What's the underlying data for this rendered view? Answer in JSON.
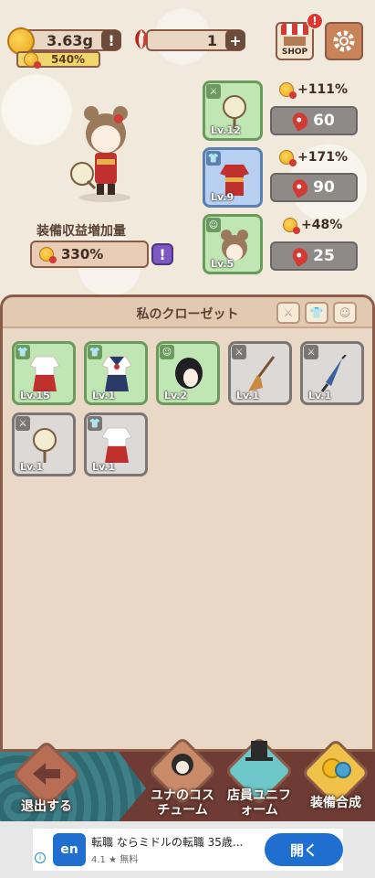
{
  "top_bar": {
    "coin_amount": "3.63g",
    "coin_multiplier": "540%",
    "fish_amount": "1",
    "shop_label": "SHOP",
    "shop_badge": "!",
    "info_symbol": "!",
    "plus_symbol": "+"
  },
  "character": {
    "equip_label": "装備収益増加量",
    "equip_value": "330%"
  },
  "equipped": [
    {
      "level": "Lv.12",
      "bonus": "+111%",
      "cost": "60",
      "type": "weapon",
      "rarity": "green"
    },
    {
      "level": "Lv.9",
      "bonus": "+171%",
      "cost": "90",
      "type": "clothing",
      "rarity": "blue"
    },
    {
      "level": "Lv.5",
      "bonus": "+48%",
      "cost": "25",
      "type": "hair",
      "rarity": "green"
    }
  ],
  "closet": {
    "title": "私のクローゼット",
    "items": [
      {
        "level": "Lv.15",
        "type": "clothing",
        "rarity": "green",
        "art": "miko"
      },
      {
        "level": "Lv.1",
        "type": "clothing",
        "rarity": "green",
        "art": "sailor"
      },
      {
        "level": "Lv.2",
        "type": "hair",
        "rarity": "green",
        "art": "black-hair"
      },
      {
        "level": "Lv.1",
        "type": "weapon",
        "rarity": "grey",
        "art": "broom"
      },
      {
        "level": "Lv.1",
        "type": "weapon",
        "rarity": "grey",
        "art": "umbrella"
      },
      {
        "level": "Lv.1",
        "type": "weapon",
        "rarity": "grey",
        "art": "fan"
      },
      {
        "level": "Lv.1",
        "type": "clothing",
        "rarity": "grey",
        "art": "miko"
      }
    ]
  },
  "bottom_nav": {
    "back": "退出する",
    "costume": "ユナのコスチューム",
    "uniform": "店員ユニフォーム",
    "merge": "装備合成"
  },
  "ad": {
    "logo": "en",
    "logo_sub": "ミドルの転職",
    "title": "転職 ならミドルの転職 35歳...",
    "rating": "4.1 ★ 無料",
    "cta": "開く"
  },
  "colors": {
    "green_rarity": "#bfe6b3",
    "blue_rarity": "#b7cff0",
    "grey_rarity": "#dcd9d7",
    "accent_brown": "#8a5b46"
  }
}
